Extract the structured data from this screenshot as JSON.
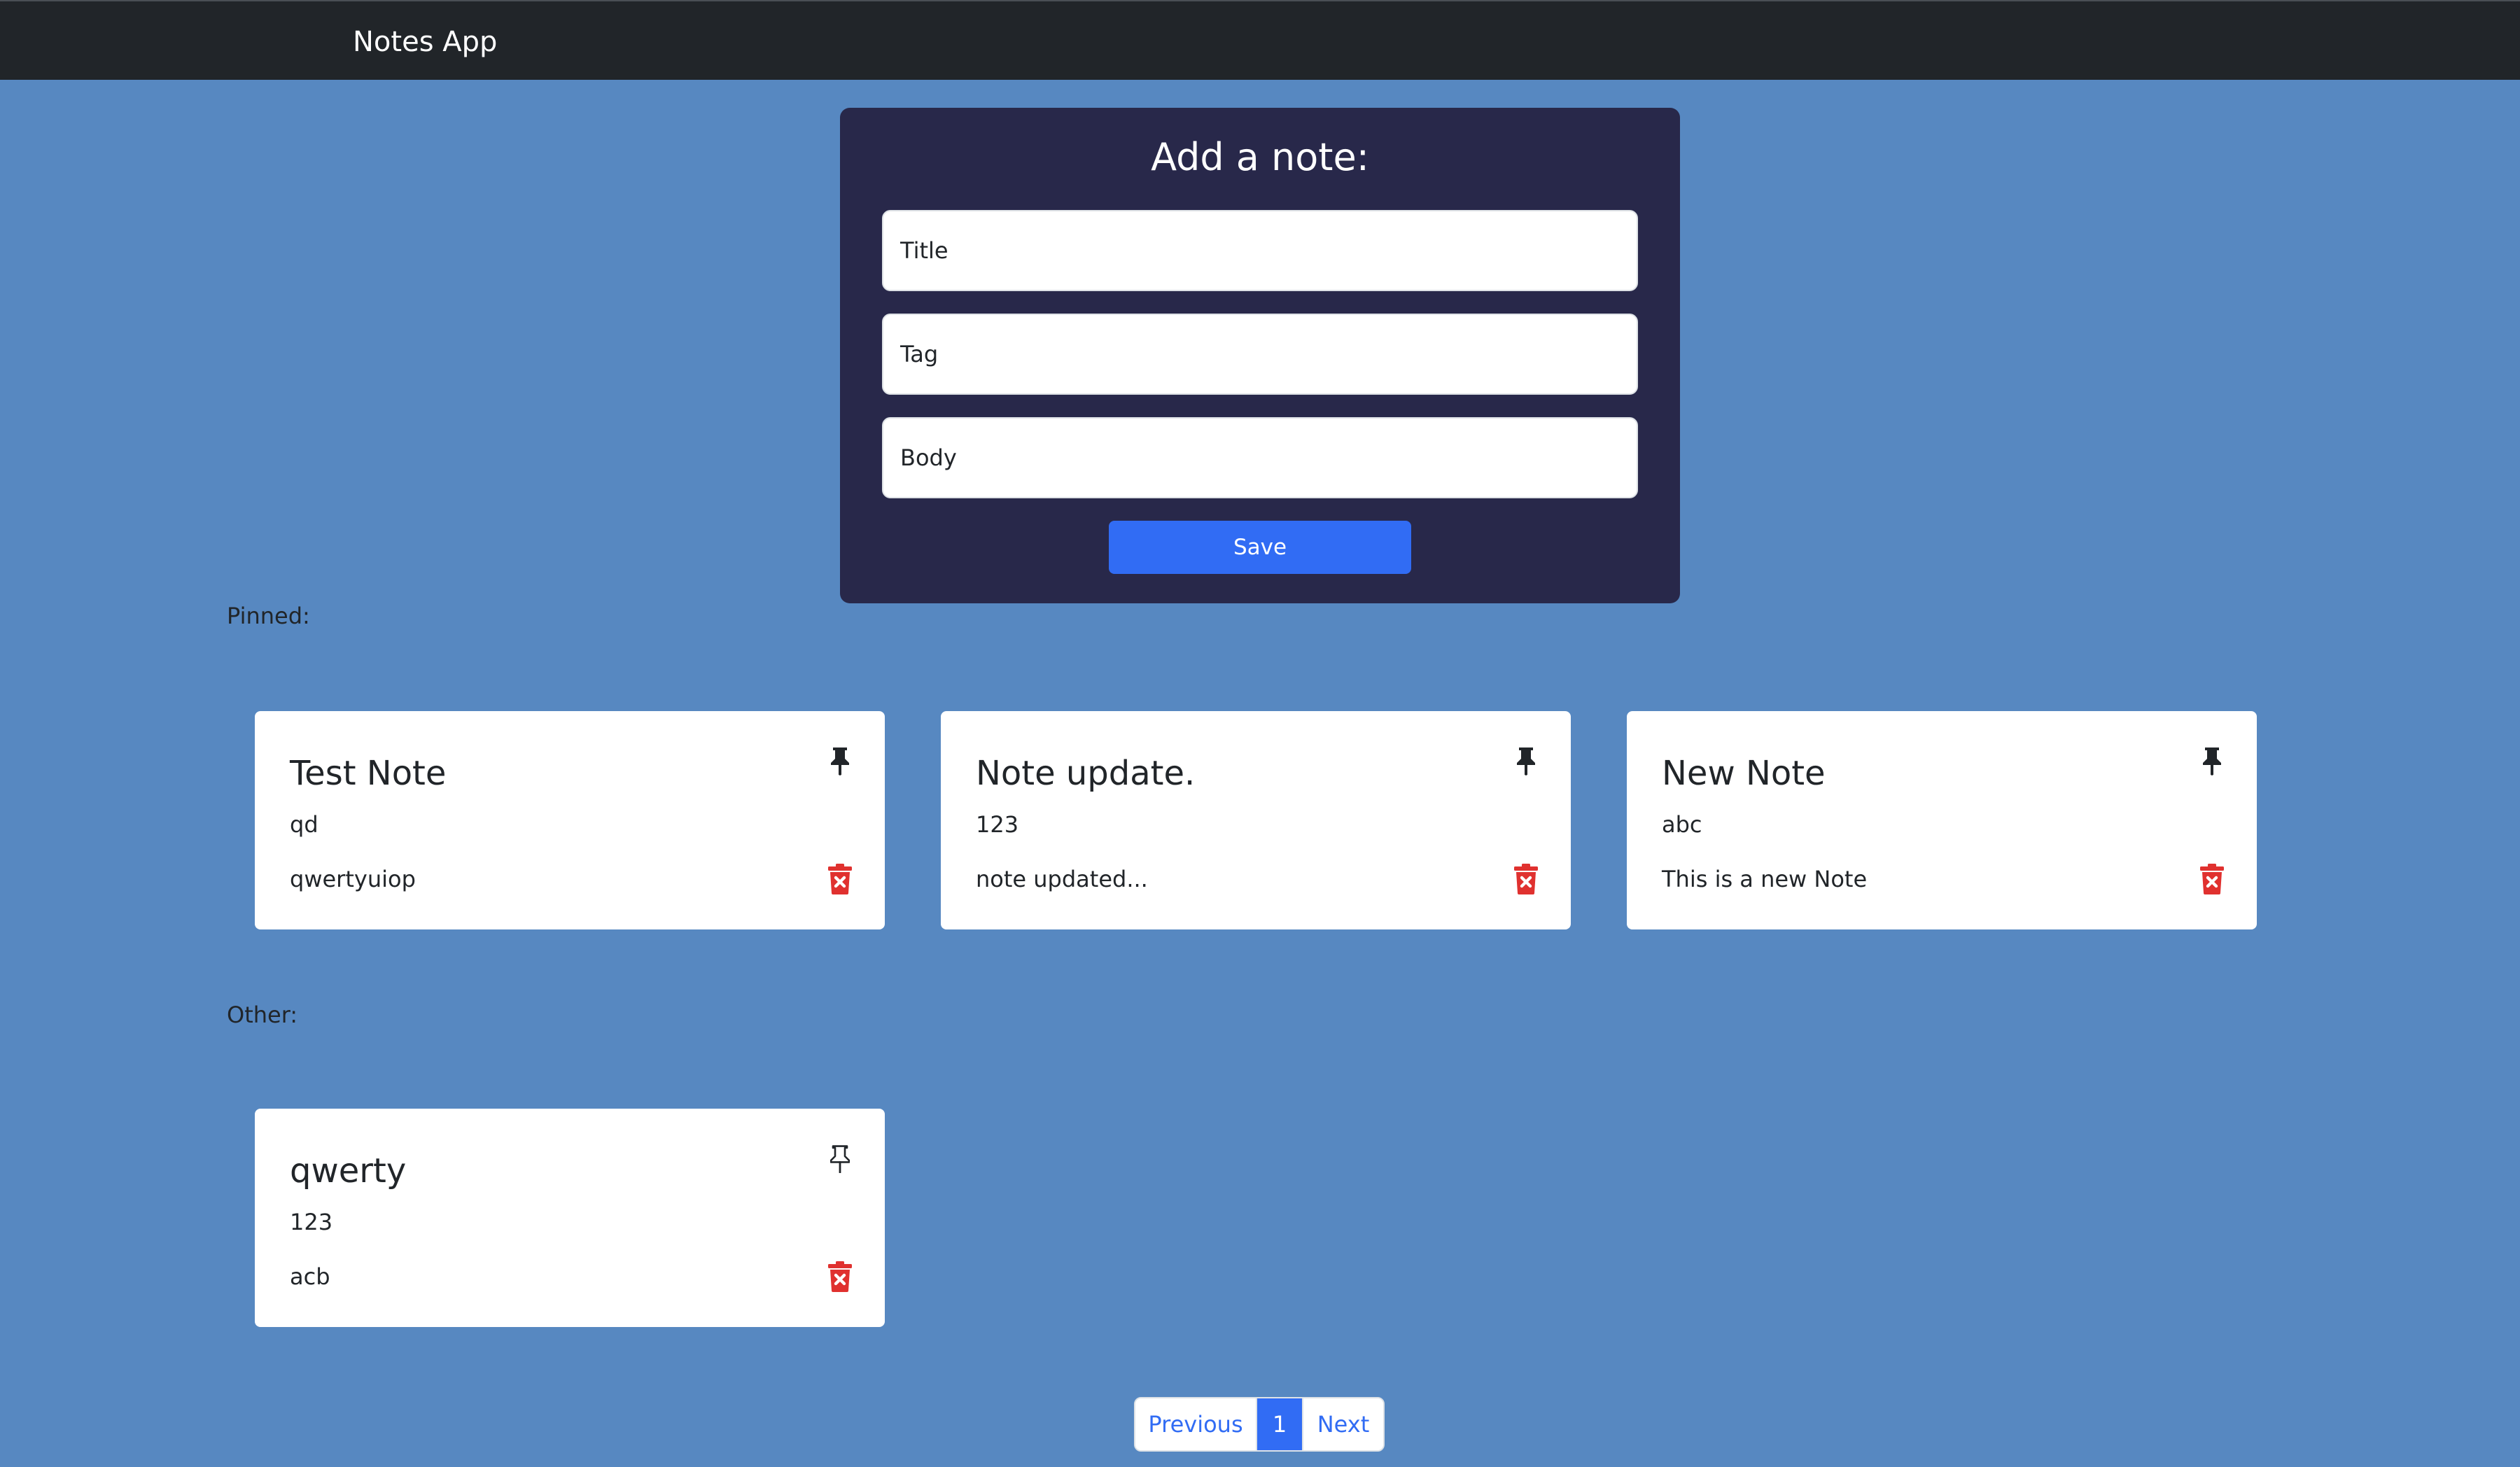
{
  "navbar": {
    "brand": "Notes App"
  },
  "add_note": {
    "heading": "Add a note:",
    "title_placeholder": "Title",
    "tag_placeholder": "Tag",
    "body_placeholder": "Body",
    "save_label": "Save"
  },
  "sections": {
    "pinned_label": "Pinned:",
    "other_label": "Other:"
  },
  "pinned_notes": [
    {
      "title": "Test Note",
      "tag": "qd",
      "body": "qwertyuiop",
      "pinned": true
    },
    {
      "title": "Note update.",
      "tag": "123",
      "body": "note updated...",
      "pinned": true
    },
    {
      "title": "New Note",
      "tag": "abc",
      "body": "This is a new Note",
      "pinned": true
    }
  ],
  "other_notes": [
    {
      "title": "qwerty",
      "tag": "123",
      "body": "acb",
      "pinned": false
    }
  ],
  "pagination": {
    "previous_label": "Previous",
    "current_page": "1",
    "next_label": "Next"
  },
  "icons": {
    "pin_filled": "pin-filled-icon",
    "pin_outline": "pin-outline-icon",
    "delete": "trash-x-icon"
  },
  "colors": {
    "page_background": "#5788c1",
    "navbar": "#212529",
    "form_card": "#28284a",
    "accent": "#316cf4",
    "delete": "#e0312f"
  }
}
